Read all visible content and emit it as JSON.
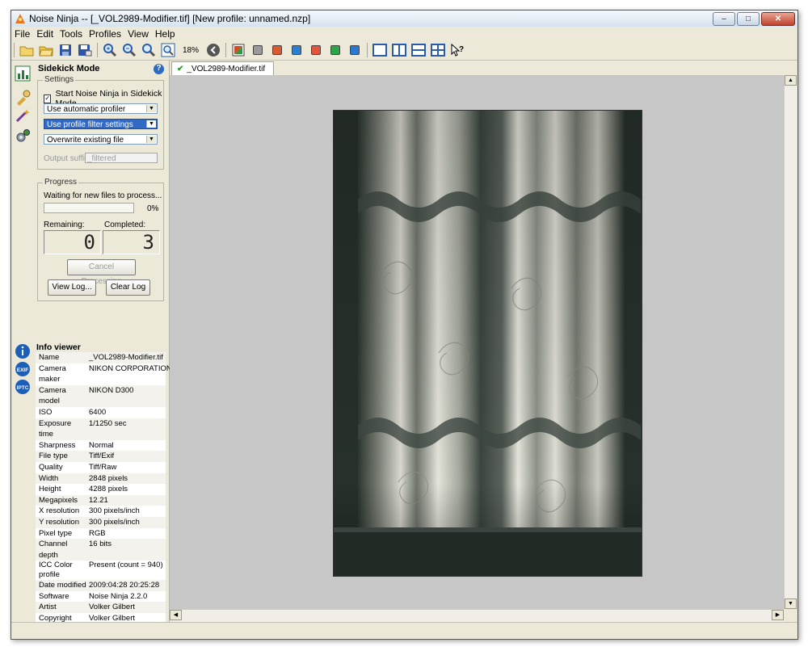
{
  "window": {
    "title": "Noise Ninja -- [_VOL2989-Modifier.tif] [New profile: unnamed.nzp]",
    "controls": {
      "minimize": "–",
      "maximize": "□",
      "close": "✕"
    }
  },
  "menu": [
    "File",
    "Edit",
    "Tools",
    "Profiles",
    "View",
    "Help"
  ],
  "toolbar": {
    "zoom": "18%",
    "icons": [
      "new-folder-icon",
      "open-folder-icon",
      "save-icon",
      "save-as-icon",
      "zoom-in-icon",
      "zoom-out-icon",
      "zoom-actual-icon",
      "zoom-fit-icon",
      "navigate-back-icon",
      "color-profile-icon",
      "gray-channel-icon",
      "red-channel-icon",
      "blue-channel-icon",
      "red-square-icon",
      "green-square-icon",
      "blue-square-icon",
      "single-view-icon",
      "split-vertical-icon",
      "split-horizontal-icon",
      "quad-view-icon",
      "help-pointer-icon"
    ]
  },
  "sidekick": {
    "title": "Sidekick Mode",
    "settings_legend": "Settings",
    "start_checkbox": {
      "label": "Start Noise Ninja in Sidekick Mode",
      "checked": true
    },
    "profiler_select": "Use automatic profiler",
    "filter_select": "Use profile filter settings",
    "file_select": "Overwrite existing file",
    "output_suffix_label": "Output suffix:",
    "output_suffix_value": "_filtered",
    "progress_legend": "Progress",
    "status": "Waiting for new files to process...",
    "progress_percent": "0%",
    "progress_fraction": 0.0,
    "remaining_label": "Remaining:",
    "completed_label": "Completed:",
    "remaining_value": "0",
    "completed_value": "3",
    "cancel_button": "Cancel Processing",
    "view_log_button": "View Log...",
    "clear_log_button": "Clear Log"
  },
  "info": {
    "title": "Info viewer",
    "rows": [
      {
        "key": "Name",
        "value": "_VOL2989-Modifier.tif"
      },
      {
        "key": "Camera maker",
        "value": "NIKON CORPORATION"
      },
      {
        "key": "Camera model",
        "value": "NIKON D300"
      },
      {
        "key": "ISO",
        "value": "6400"
      },
      {
        "key": "Exposure time",
        "value": "1/1250 sec"
      },
      {
        "key": "Sharpness",
        "value": "Normal"
      },
      {
        "key": "File type",
        "value": "Tiff/Exif"
      },
      {
        "key": "Quality",
        "value": "Tiff/Raw"
      },
      {
        "key": "Width",
        "value": "2848 pixels"
      },
      {
        "key": "Height",
        "value": "4288 pixels"
      },
      {
        "key": "Megapixels",
        "value": "12.21"
      },
      {
        "key": "X resolution",
        "value": "300 pixels/inch"
      },
      {
        "key": "Y resolution",
        "value": "300 pixels/inch"
      },
      {
        "key": "Pixel type",
        "value": "RGB"
      },
      {
        "key": "Channel depth",
        "value": "16 bits"
      },
      {
        "key": "ICC Color profile",
        "value": "Present (count = 940)"
      },
      {
        "key": "Date modified",
        "value": "2009:04:28 20:25:28"
      },
      {
        "key": "Software",
        "value": "Noise Ninja 2.2.0"
      },
      {
        "key": "Artist",
        "value": "Volker Gilbert"
      },
      {
        "key": "Copyright",
        "value": "Volker Gilbert"
      }
    ],
    "side_icons": [
      "info-icon",
      "exif-icon",
      "iptc-icon"
    ],
    "side_labels": {
      "exif": "EXIF",
      "iptc": "IPTC"
    }
  },
  "tab": {
    "label": "_VOL2989-Modifier.tif"
  },
  "colors": {
    "selection": "#316ac5",
    "viewer_bg": "#c7c7c7",
    "chrome": "#ece9d8"
  }
}
